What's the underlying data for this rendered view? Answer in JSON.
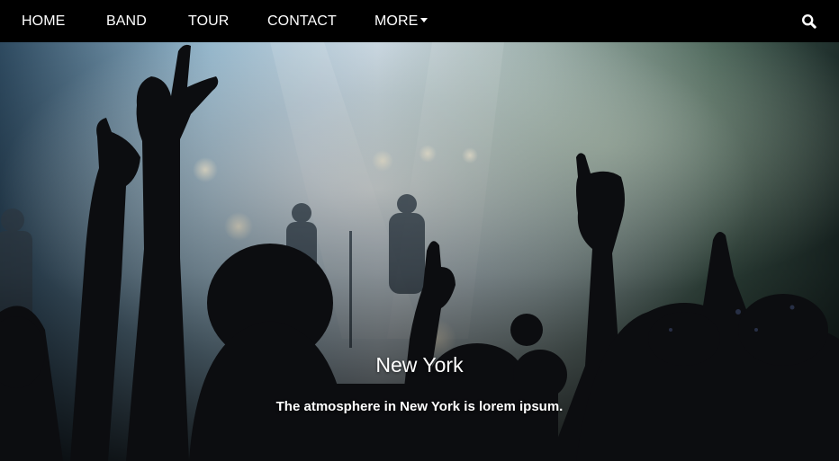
{
  "nav": {
    "items": [
      {
        "label": "HOME"
      },
      {
        "label": "BAND"
      },
      {
        "label": "TOUR"
      },
      {
        "label": "CONTACT"
      },
      {
        "label": "MORE"
      }
    ],
    "more_icon": "caret-down-icon",
    "search_icon": "search-icon"
  },
  "hero": {
    "image": "concert-crowd-photo",
    "caption_title": "New York",
    "caption_text": "The atmosphere in New York is lorem ipsum."
  },
  "colors": {
    "navbar_bg": "#000000",
    "nav_text": "#ffffff",
    "caption_text": "#ffffff"
  }
}
